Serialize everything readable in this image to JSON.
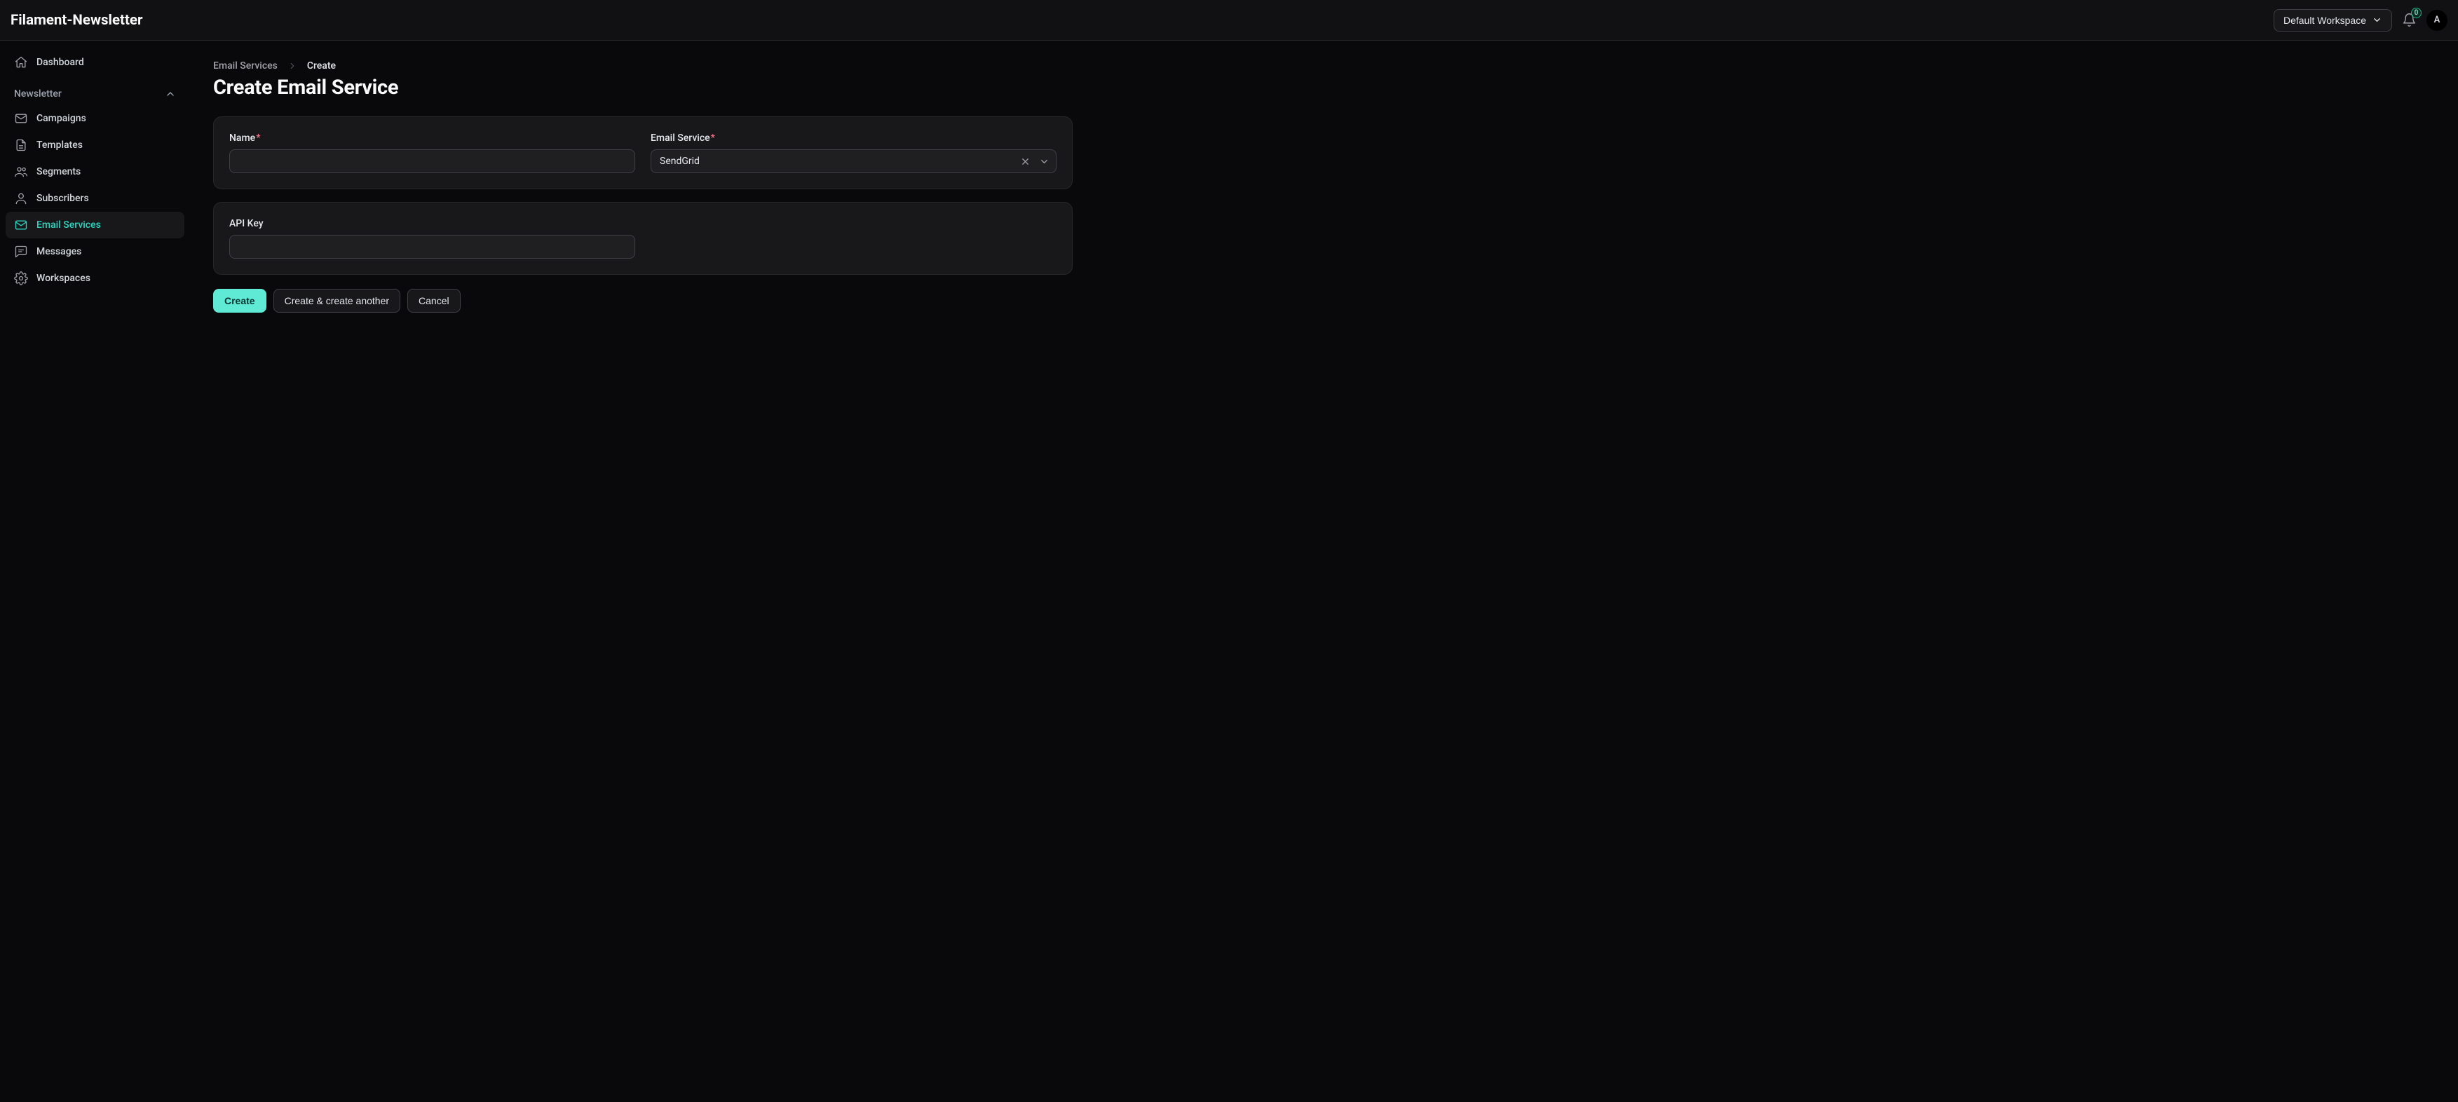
{
  "app_title": "Filament-Newsletter",
  "header": {
    "workspace_label": "Default Workspace",
    "notification_count": "0",
    "avatar_initial": "A"
  },
  "sidebar": {
    "dashboard_label": "Dashboard",
    "group_label": "Newsletter",
    "items": [
      {
        "label": "Campaigns"
      },
      {
        "label": "Templates"
      },
      {
        "label": "Segments"
      },
      {
        "label": "Subscribers"
      },
      {
        "label": "Email Services"
      },
      {
        "label": "Messages"
      },
      {
        "label": "Workspaces"
      }
    ]
  },
  "breadcrumbs": {
    "root": "Email Services",
    "current": "Create"
  },
  "page_title": "Create Email Service",
  "form": {
    "name_label": "Name",
    "name_value": "",
    "service_label": "Email Service",
    "service_value": "SendGrid",
    "api_key_label": "API Key",
    "api_key_value": ""
  },
  "actions": {
    "create": "Create",
    "create_another": "Create & create another",
    "cancel": "Cancel"
  },
  "colors": {
    "accent": "#5eead4",
    "accent_text": "#2dd4bf",
    "surface": "#18181b",
    "border": "#3f3f46",
    "danger": "#fb7185"
  }
}
